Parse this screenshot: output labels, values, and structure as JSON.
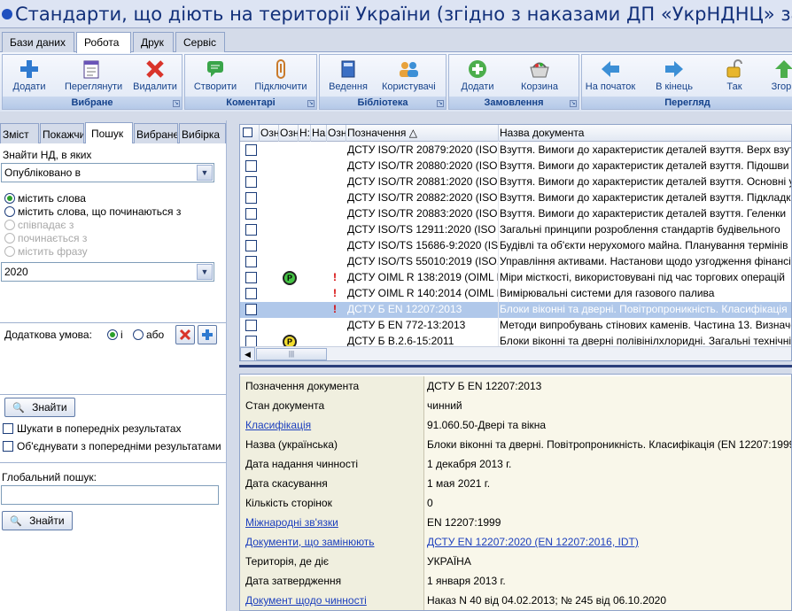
{
  "window": {
    "title": "Стандарти, що діють на території України (згідно з наказами ДП «УкрНДНЦ» за вересень 20..."
  },
  "menu_tabs": [
    "Бази даних",
    "Робота",
    "Друк",
    "Сервіс"
  ],
  "ribbon": {
    "groups": [
      {
        "label": "Вибране",
        "buttons": [
          "Додати",
          "Переглянути",
          "Видалити"
        ]
      },
      {
        "label": "Коментарі",
        "buttons": [
          "Створити",
          "Підключити"
        ]
      },
      {
        "label": "Бібліотека",
        "buttons": [
          "Ведення",
          "Користувачі"
        ]
      },
      {
        "label": "Замовлення",
        "buttons": [
          "Додати",
          "Корзина"
        ]
      },
      {
        "label": "Перегляд",
        "buttons": [
          "На початок",
          "В кінець",
          "Так",
          "Згорн"
        ]
      }
    ]
  },
  "left_panel": {
    "tabs": [
      "Зміст",
      "Покажчи",
      "Пошук",
      "Вибране",
      "Вибірка"
    ],
    "find_label": "Знайти НД, в яких",
    "field_combo": "Опубліковано в",
    "radios": [
      "містить слова",
      "містить слова, що починаються з",
      "співпадає з",
      "починається з",
      "містить фразу"
    ],
    "value_combo": "2020",
    "extra_condition": {
      "label": "Додаткова умова:",
      "and": "і",
      "or": "або"
    },
    "find_button": "Знайти",
    "checkbox_prev": "Шукати в попередніх результатах",
    "checkbox_merge": "Об'єднувати з попередніми результатами",
    "global_search_label": "Глобальний пошук:",
    "global_find_button": "Знайти"
  },
  "grid": {
    "headers": [
      "Озн",
      "Озн",
      "Н:",
      "На:",
      "Озн",
      "Позначення",
      "Назва документа"
    ],
    "rows": [
      {
        "code": "ДСТУ ISO/TR 20879:2020 (ISO",
        "name": "Взуття. Вимоги до характеристик деталей взуття. Верх взуття",
        "medal": "",
        "mark": false
      },
      {
        "code": "ДСТУ ISO/TR 20880:2020 (ISO",
        "name": "Взуття. Вимоги до характеристик деталей взуття. Підошви",
        "medal": "",
        "mark": false
      },
      {
        "code": "ДСТУ ISO/TR 20881:2020 (ISO",
        "name": "Взуття. Вимоги до характеристик деталей взуття. Основні устілки",
        "medal": "",
        "mark": false
      },
      {
        "code": "ДСТУ ISO/TR 20882:2020 (ISO",
        "name": "Взуття. Вимоги до характеристик деталей взуття. Підкладка",
        "medal": "",
        "mark": false
      },
      {
        "code": "ДСТУ ISO/TR 20883:2020 (ISO",
        "name": "Взуття. Вимоги до характеристик деталей взуття. Геленки",
        "medal": "",
        "mark": false
      },
      {
        "code": "ДСТУ ISO/TS 12911:2020 (ISO",
        "name": "Загальні принципи розроблення стандартів будівельного",
        "medal": "",
        "mark": false
      },
      {
        "code": "ДСТУ ISO/TS 15686-9:2020 (IS",
        "name": "Будівлі та об'єкти нерухомого майна. Планування термінів",
        "medal": "",
        "mark": false
      },
      {
        "code": "ДСТУ ISO/TS 55010:2019 (ISO.",
        "name": "Управління активами. Настанови щодо узгодження фінансів",
        "medal": "",
        "mark": false
      },
      {
        "code": "ДСТУ OIML R 138:2019 (OIML I",
        "name": "Міри місткості, використовувані під час торгових операцій",
        "medal": "P",
        "mark": true
      },
      {
        "code": "ДСТУ OIML R 140:2014 (OIML I",
        "name": "Вимірювальні системи для газового палива",
        "medal": "",
        "mark": true
      },
      {
        "code": "ДСТУ Б EN 12207:2013",
        "name": "Блоки віконні та дверні. Повітропроникність. Класифікація",
        "medal": "",
        "mark": true
      },
      {
        "code": "ДСТУ Б EN 772-13:2013",
        "name": "Методи випробувань стінових каменів. Частина 13. Визначення",
        "medal": "",
        "mark": false
      },
      {
        "code": "ДСТУ Б В.2.6-15:2011",
        "name": "Блоки віконні та дверні полівінілхлоридні. Загальні технічні",
        "medal": "P",
        "mark": false
      }
    ],
    "selected_row": 10,
    "medal_colors": [
      "green",
      "yellow"
    ]
  },
  "details": [
    {
      "label": "Позначення документа",
      "value": "ДСТУ Б EN 12207:2013",
      "label_link": false,
      "value_link": false
    },
    {
      "label": "Стан документа",
      "value": "чинний",
      "label_link": false,
      "value_link": false
    },
    {
      "label": "Класифікація",
      "value": "91.060.50-Двері та вікна",
      "label_link": true,
      "value_link": false
    },
    {
      "label": "Назва (українська)",
      "value": "Блоки віконні та дверні. Повітропроникність. Класифікація (EN 12207:1999",
      "label_link": false,
      "value_link": false
    },
    {
      "label": "Дата надання чинності",
      "value": "1 декабря 2013 г.",
      "label_link": false,
      "value_link": false
    },
    {
      "label": "Дата скасування",
      "value": "1 мая 2021 г.",
      "label_link": false,
      "value_link": false
    },
    {
      "label": "Кількість сторінок",
      "value": "0",
      "label_link": false,
      "value_link": false
    },
    {
      "label": "Міжнародні зв'язки",
      "value": "EN 12207:1999",
      "label_link": true,
      "value_link": false
    },
    {
      "label": "Документи, що замінюють",
      "value": "ДСТУ EN 12207:2020 (EN 12207:2016, IDT)",
      "label_link": true,
      "value_link": true
    },
    {
      "label": "Територія, де діє",
      "value": "УКРАЇНА",
      "label_link": false,
      "value_link": false
    },
    {
      "label": "Дата затвердження",
      "value": "1 января 2013 г.",
      "label_link": false,
      "value_link": false
    },
    {
      "label": "Документ щодо чинності",
      "value": "Наказ N 40 від 04.02.2013; № 245 від 06.10.2020",
      "label_link": true,
      "value_link": false
    }
  ],
  "colors": {
    "accent": "#15428b",
    "title": "#12307a",
    "link": "#1c3fbd",
    "selected_row": "#b0c8ea",
    "alert": "#d40000"
  }
}
